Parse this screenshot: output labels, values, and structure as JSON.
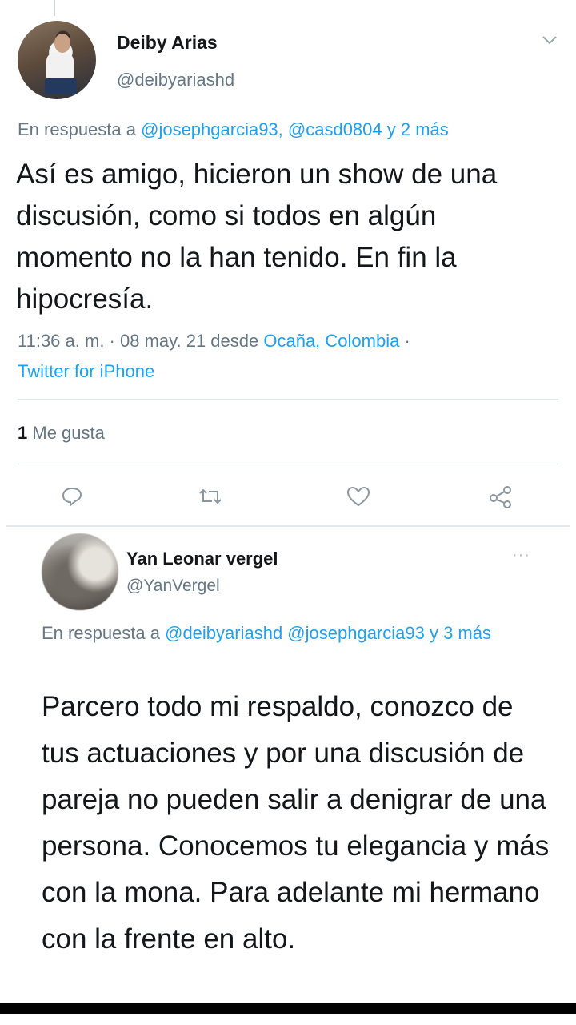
{
  "tweet1": {
    "author_name": "Deiby Arias",
    "author_handle": "@deibyariashd",
    "reply_prefix": "En respuesta a ",
    "reply_mentions": "@josephgarcia93, @casd0804 y 2 más",
    "text": "Así es amigo, hicieron un show de una discusión, como si todos en algún momento no la han tenido. En fin la hipocresía.",
    "timestamp": "11:36 a. m. · 08 may. 21 desde ",
    "location": "Ocaña, Colombia",
    "separator": " ·",
    "source": "Twitter for iPhone",
    "likes_count": "1",
    "likes_label": " Me gusta",
    "icons": [
      "chevron-down-icon",
      "reply-icon",
      "retweet-icon",
      "like-icon",
      "share-icon"
    ]
  },
  "tweet2": {
    "author_name": "Yan Leonar vergel",
    "author_handle": "@YanVergel",
    "more_label": "···",
    "reply_prefix": "En respuesta a ",
    "reply_mentions": "@deibyariashd @josephgarcia93 y 3 más",
    "text": "Parcero todo mi respaldo, conozco de tus actuaciones y por una discusión de pareja no pueden salir a denigrar de una persona. Conocemos tu elegancia y más con la mona. Para adelante mi hermano con la frente en alto."
  },
  "colors": {
    "link": "#1da1f2",
    "secondary_text": "#657786",
    "primary_text": "#14171a"
  }
}
